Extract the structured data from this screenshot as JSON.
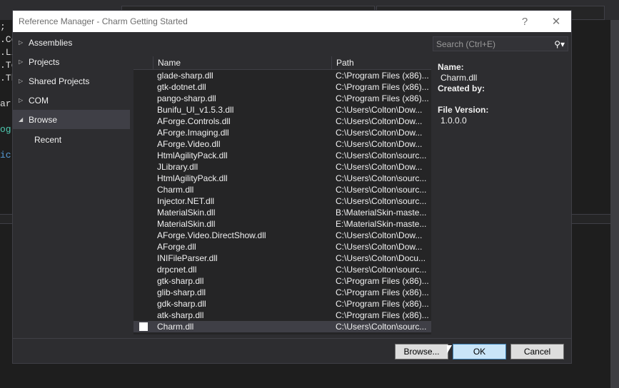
{
  "background": {
    "code_fragments": [
      ";",
      ".Co",
      ".Li",
      ".Te",
      ".Th",
      "arr",
      "og",
      "ic"
    ]
  },
  "dialog": {
    "title": "Reference Manager - Charm Getting Started",
    "help": "?",
    "close": "✕"
  },
  "nav": {
    "items": [
      {
        "label": "Assemblies",
        "arrow": "▷"
      },
      {
        "label": "Projects",
        "arrow": "▷"
      },
      {
        "label": "Shared Projects",
        "arrow": "▷"
      },
      {
        "label": "COM",
        "arrow": "▷"
      },
      {
        "label": "Browse",
        "arrow": "◢"
      }
    ],
    "sub": "Recent"
  },
  "search": {
    "placeholder": "Search (Ctrl+E)",
    "icon": "⚲▾"
  },
  "table": {
    "headers": [
      "Name",
      "Path"
    ],
    "rows": [
      [
        "glade-sharp.dll",
        "C:\\Program Files (x86)..."
      ],
      [
        "gtk-dotnet.dll",
        "C:\\Program Files (x86)..."
      ],
      [
        "pango-sharp.dll",
        "C:\\Program Files (x86)..."
      ],
      [
        "Bunifu_UI_v1.5.3.dll",
        "C:\\Users\\Colton\\Dow..."
      ],
      [
        "AForge.Controls.dll",
        "C:\\Users\\Colton\\Dow..."
      ],
      [
        "AForge.Imaging.dll",
        "C:\\Users\\Colton\\Dow..."
      ],
      [
        "AForge.Video.dll",
        "C:\\Users\\Colton\\Dow..."
      ],
      [
        "HtmlAgilityPack.dll",
        "C:\\Users\\Colton\\sourc..."
      ],
      [
        "JLibrary.dll",
        "C:\\Users\\Colton\\Dow..."
      ],
      [
        "HtmlAgilityPack.dll",
        "C:\\Users\\Colton\\sourc..."
      ],
      [
        "Charm.dll",
        "C:\\Users\\Colton\\sourc..."
      ],
      [
        "Injector.NET.dll",
        "C:\\Users\\Colton\\sourc..."
      ],
      [
        "MaterialSkin.dll",
        "B:\\MaterialSkin-maste..."
      ],
      [
        "MaterialSkin.dll",
        "E:\\MaterialSkin-maste..."
      ],
      [
        "AForge.Video.DirectShow.dll",
        "C:\\Users\\Colton\\Dow..."
      ],
      [
        "AForge.dll",
        "C:\\Users\\Colton\\Dow..."
      ],
      [
        "INIFileParser.dll",
        "C:\\Users\\Colton\\Docu..."
      ],
      [
        "drpcnet.dll",
        "C:\\Users\\Colton\\sourc..."
      ],
      [
        "gtk-sharp.dll",
        "C:\\Program Files (x86)..."
      ],
      [
        "glib-sharp.dll",
        "C:\\Program Files (x86)..."
      ],
      [
        "gdk-sharp.dll",
        "C:\\Program Files (x86)..."
      ],
      [
        "atk-sharp.dll",
        "C:\\Program Files (x86)..."
      ],
      [
        "Charm.dll",
        "C:\\Users\\Colton\\sourc..."
      ]
    ]
  },
  "info": {
    "name_label": "Name:",
    "name": "Charm.dll",
    "created_label": "Created by:",
    "version_label": "File Version:",
    "version": "1.0.0.0"
  },
  "buttons": {
    "browse": "Browse...",
    "ok": "OK",
    "cancel": "Cancel"
  }
}
